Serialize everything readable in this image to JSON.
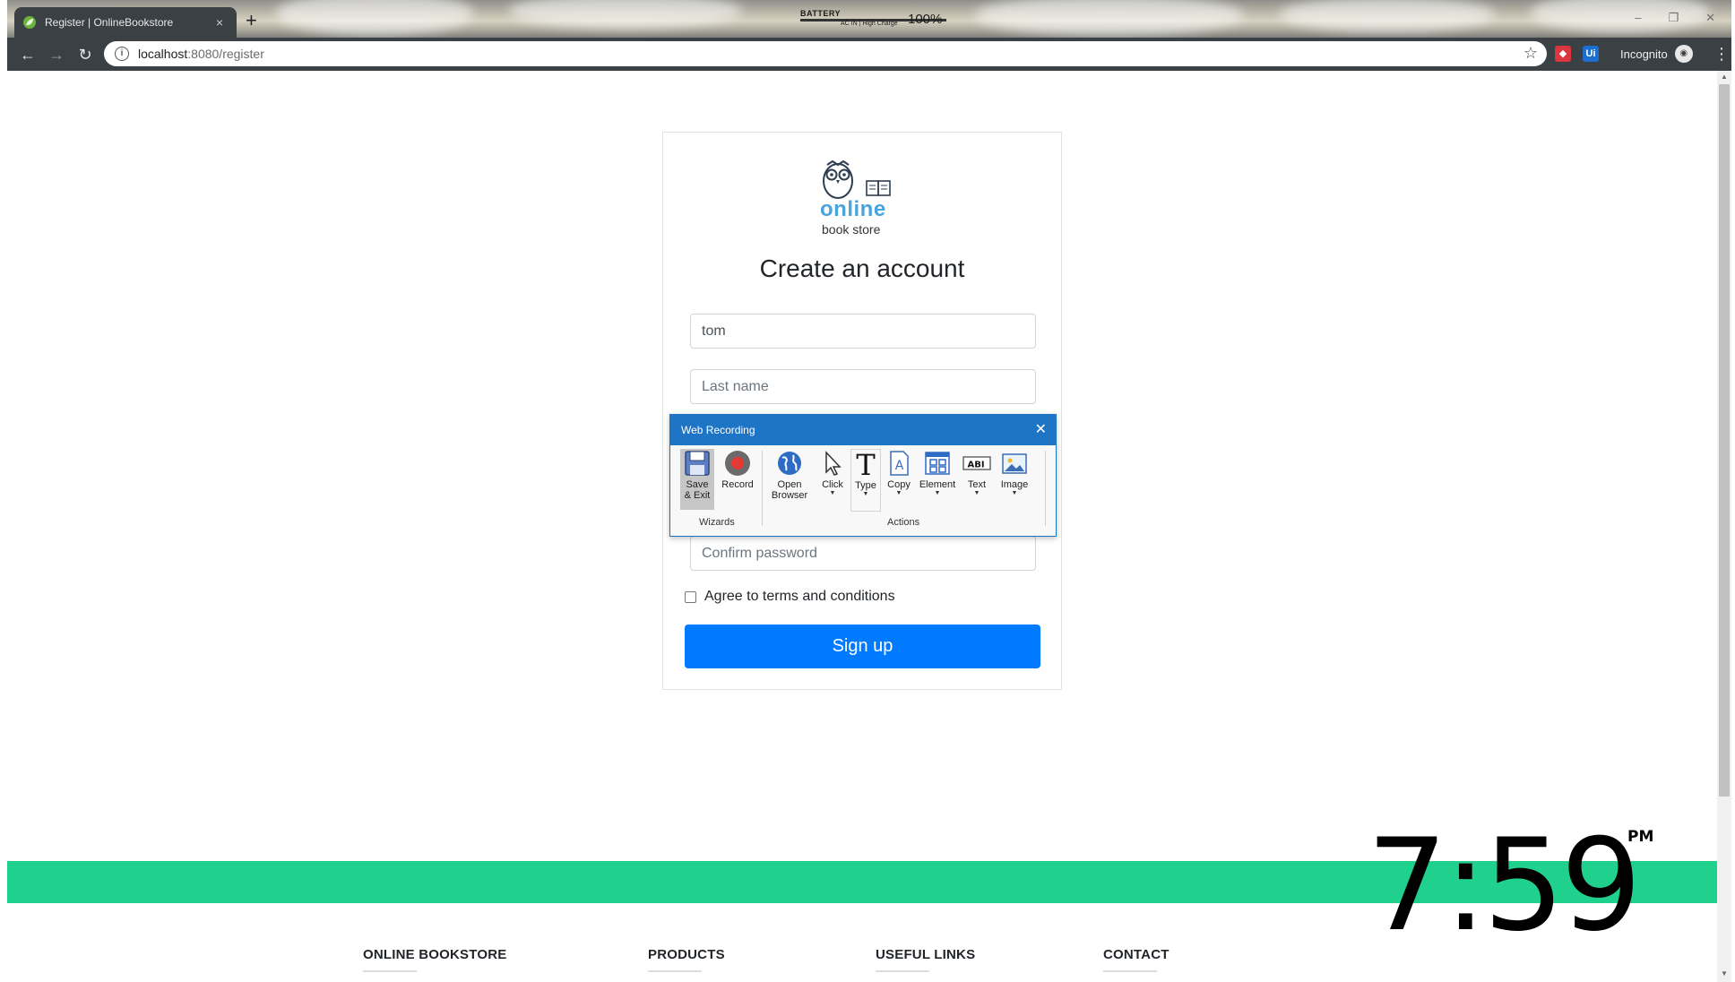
{
  "browser": {
    "tab_title": "Register | OnlineBookstore",
    "tab_close": "×",
    "new_tab": "+",
    "url_host": "localhost",
    "url_path": ":8080/register",
    "incognito_label": "Incognito",
    "battery": {
      "label": "BATTERY",
      "status": "AC IN  |  High Charge",
      "percent": "100%"
    },
    "window_buttons": [
      "–",
      "❐",
      "✕"
    ]
  },
  "logo": {
    "line1": "online",
    "line2": "book store"
  },
  "form": {
    "title": "Create an account",
    "first_name_value": "tom",
    "last_name_placeholder": "Last name",
    "confirm_password_placeholder": "Confirm password",
    "terms_label": "Agree to terms and conditions",
    "submit_label": "Sign up"
  },
  "recorder": {
    "title": "Web Recording",
    "buttons": {
      "save_exit": "Save\n& Exit",
      "record": "Record",
      "open_browser": "Open\nBrowser",
      "click": "Click",
      "type": "Type",
      "copy": "Copy",
      "element": "Element",
      "text": "Text",
      "image": "Image"
    },
    "groups": {
      "wizards": "Wizards",
      "actions": "Actions"
    }
  },
  "footer": {
    "columns": [
      "ONLINE BOOKSTORE",
      "PRODUCTS",
      "USEFUL LINKS",
      "CONTACT"
    ],
    "accent_color": "#20d08d"
  },
  "clock": {
    "time": "7:59",
    "ampm": "PM"
  },
  "colors": {
    "primary": "#007bff",
    "recorder_blue": "#1e74c5",
    "chrome_dark": "#3b4045"
  }
}
